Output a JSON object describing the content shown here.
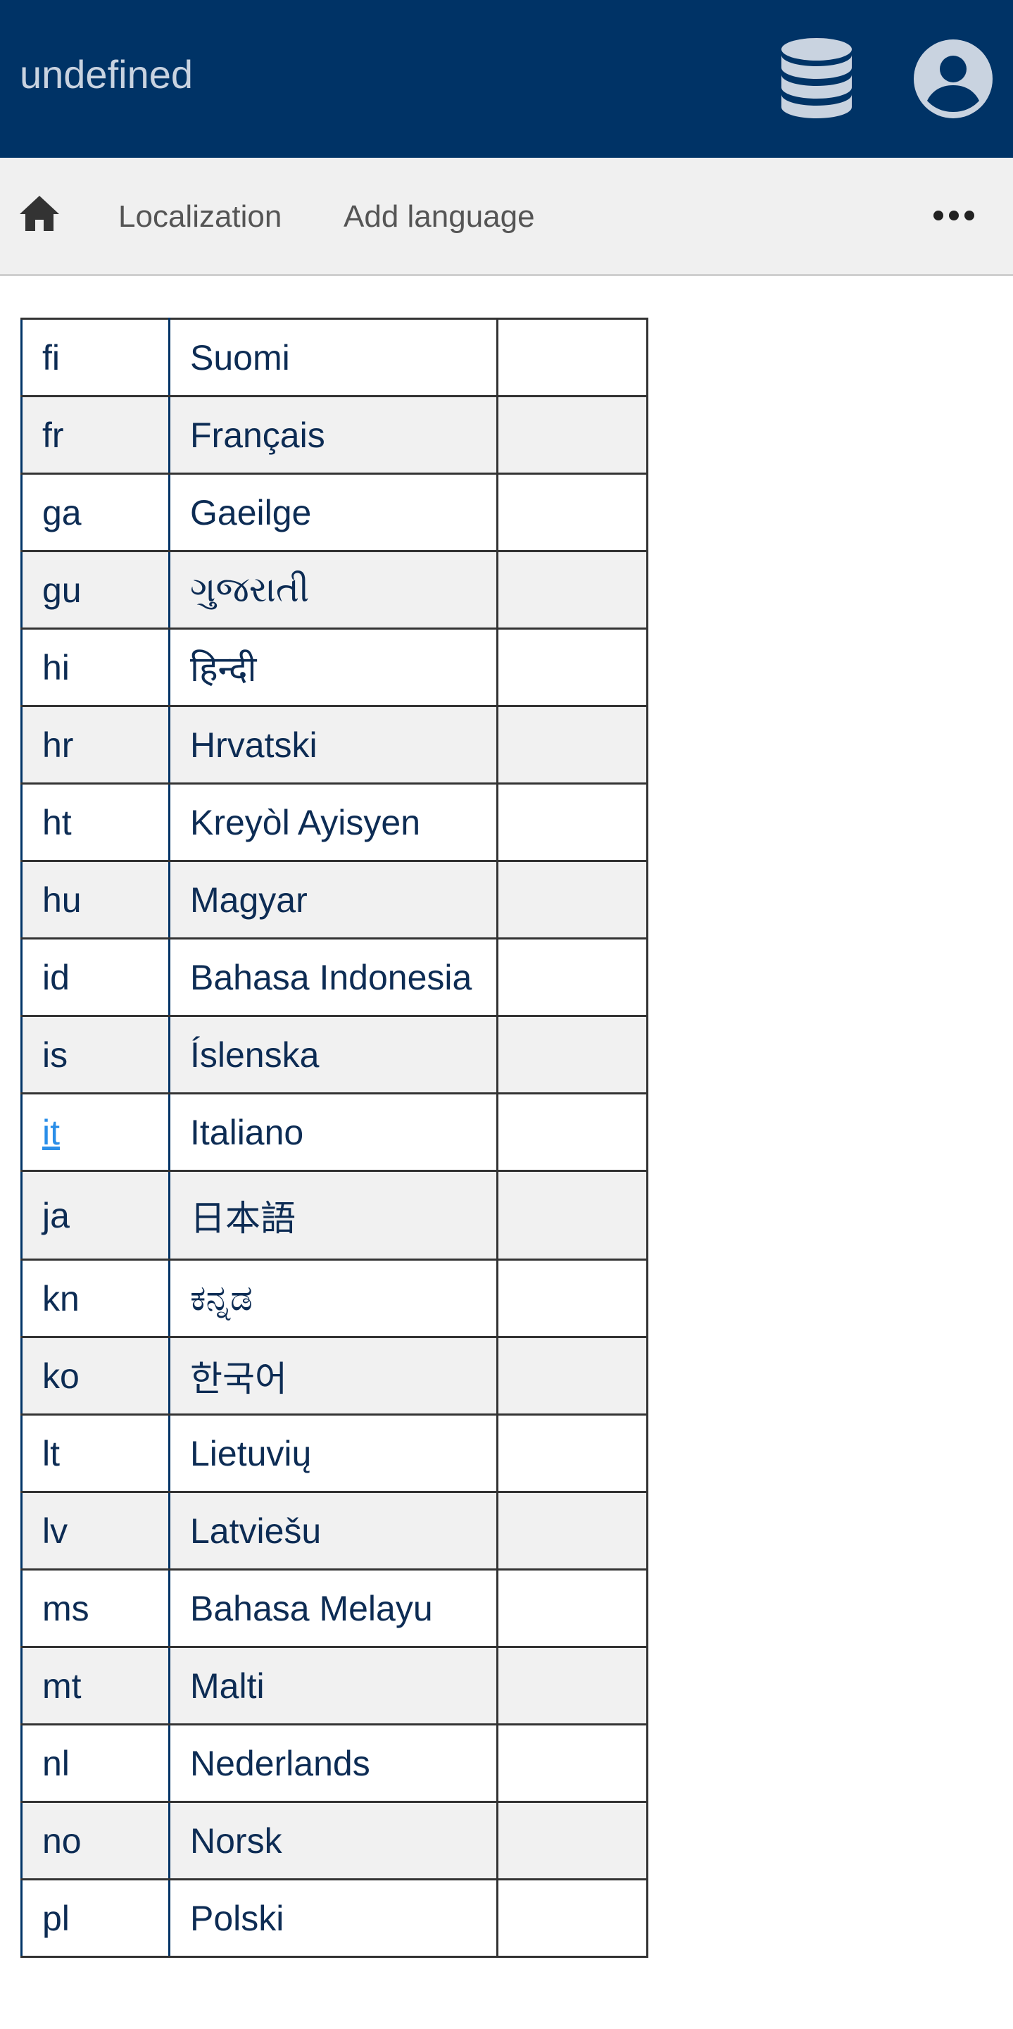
{
  "header": {
    "title": "undefined",
    "icons": [
      "database-icon",
      "account-circle-icon"
    ],
    "background_color": "#003366"
  },
  "nav": {
    "home_icon": "home-icon",
    "items": [
      {
        "label": "Localization"
      },
      {
        "label": "Add language"
      }
    ],
    "more_icon": "more-horizontal-icon"
  },
  "languages": [
    {
      "code": "fi",
      "name": "Suomi"
    },
    {
      "code": "fr",
      "name": "Français"
    },
    {
      "code": "ga",
      "name": "Gaeilge"
    },
    {
      "code": "gu",
      "name": "ગુજરાતી"
    },
    {
      "code": "hi",
      "name": "हिन्दी"
    },
    {
      "code": "hr",
      "name": "Hrvatski"
    },
    {
      "code": "ht",
      "name": "Kreyòl Ayisyen"
    },
    {
      "code": "hu",
      "name": "Magyar"
    },
    {
      "code": "id",
      "name": "Bahasa Indonesia"
    },
    {
      "code": "is",
      "name": "Íslenska"
    },
    {
      "code": "it",
      "name": "Italiano",
      "link": true
    },
    {
      "code": "ja",
      "name": "日本語"
    },
    {
      "code": "kn",
      "name": "ಕನ್ನಡ"
    },
    {
      "code": "ko",
      "name": "한국어"
    },
    {
      "code": "lt",
      "name": "Lietuvių"
    },
    {
      "code": "lv",
      "name": "Latviešu"
    },
    {
      "code": "ms",
      "name": "Bahasa Melayu"
    },
    {
      "code": "mt",
      "name": "Malti"
    },
    {
      "code": "nl",
      "name": "Nederlands"
    },
    {
      "code": "no",
      "name": "Norsk"
    },
    {
      "code": "pl",
      "name": "Polski"
    }
  ],
  "colors": {
    "link": "#2a8ee8",
    "text": "#0d2c54",
    "row_alt": "#f1f1f1"
  }
}
